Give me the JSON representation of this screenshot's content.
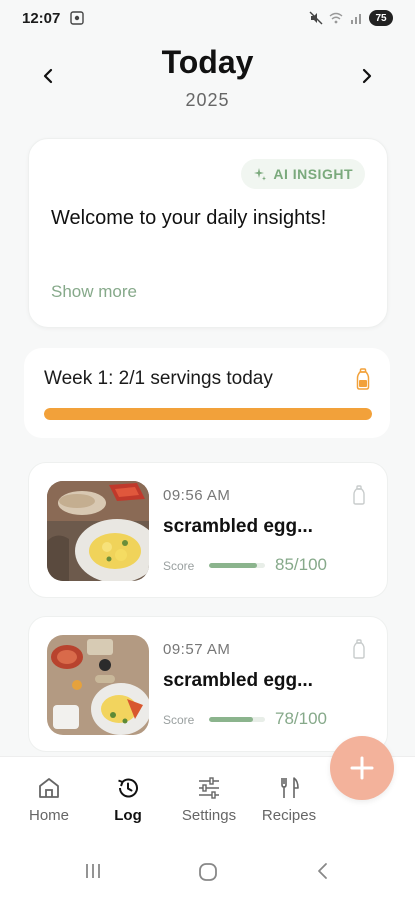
{
  "status_bar": {
    "time": "12:07",
    "battery": "75"
  },
  "header": {
    "title": "Today",
    "year": "2025"
  },
  "insight": {
    "badge_label": "AI INSIGHT",
    "text": "Welcome to your daily insights!",
    "show_more": "Show more"
  },
  "week": {
    "text": "Week 1: 2/1 servings today",
    "progress": 1.0
  },
  "meals": [
    {
      "time": "09:56 AM",
      "title": "scrambled egg...",
      "score_label": "Score",
      "score_value": "85/100",
      "score_fraction": 0.85
    },
    {
      "time": "09:57 AM",
      "title": "scrambled egg...",
      "score_label": "Score",
      "score_value": "78/100",
      "score_fraction": 0.78
    }
  ],
  "bottom_nav": {
    "items": [
      {
        "label": "Home",
        "icon": "home-icon",
        "active": false
      },
      {
        "label": "Log",
        "icon": "history-icon",
        "active": true
      },
      {
        "label": "Settings",
        "icon": "sliders-icon",
        "active": false
      },
      {
        "label": "Recipes",
        "icon": "fork-knife-icon",
        "active": false
      }
    ]
  },
  "colors": {
    "accent_green": "#86a98a",
    "progress_orange": "#f2a13a",
    "fab": "#f3b29b"
  }
}
